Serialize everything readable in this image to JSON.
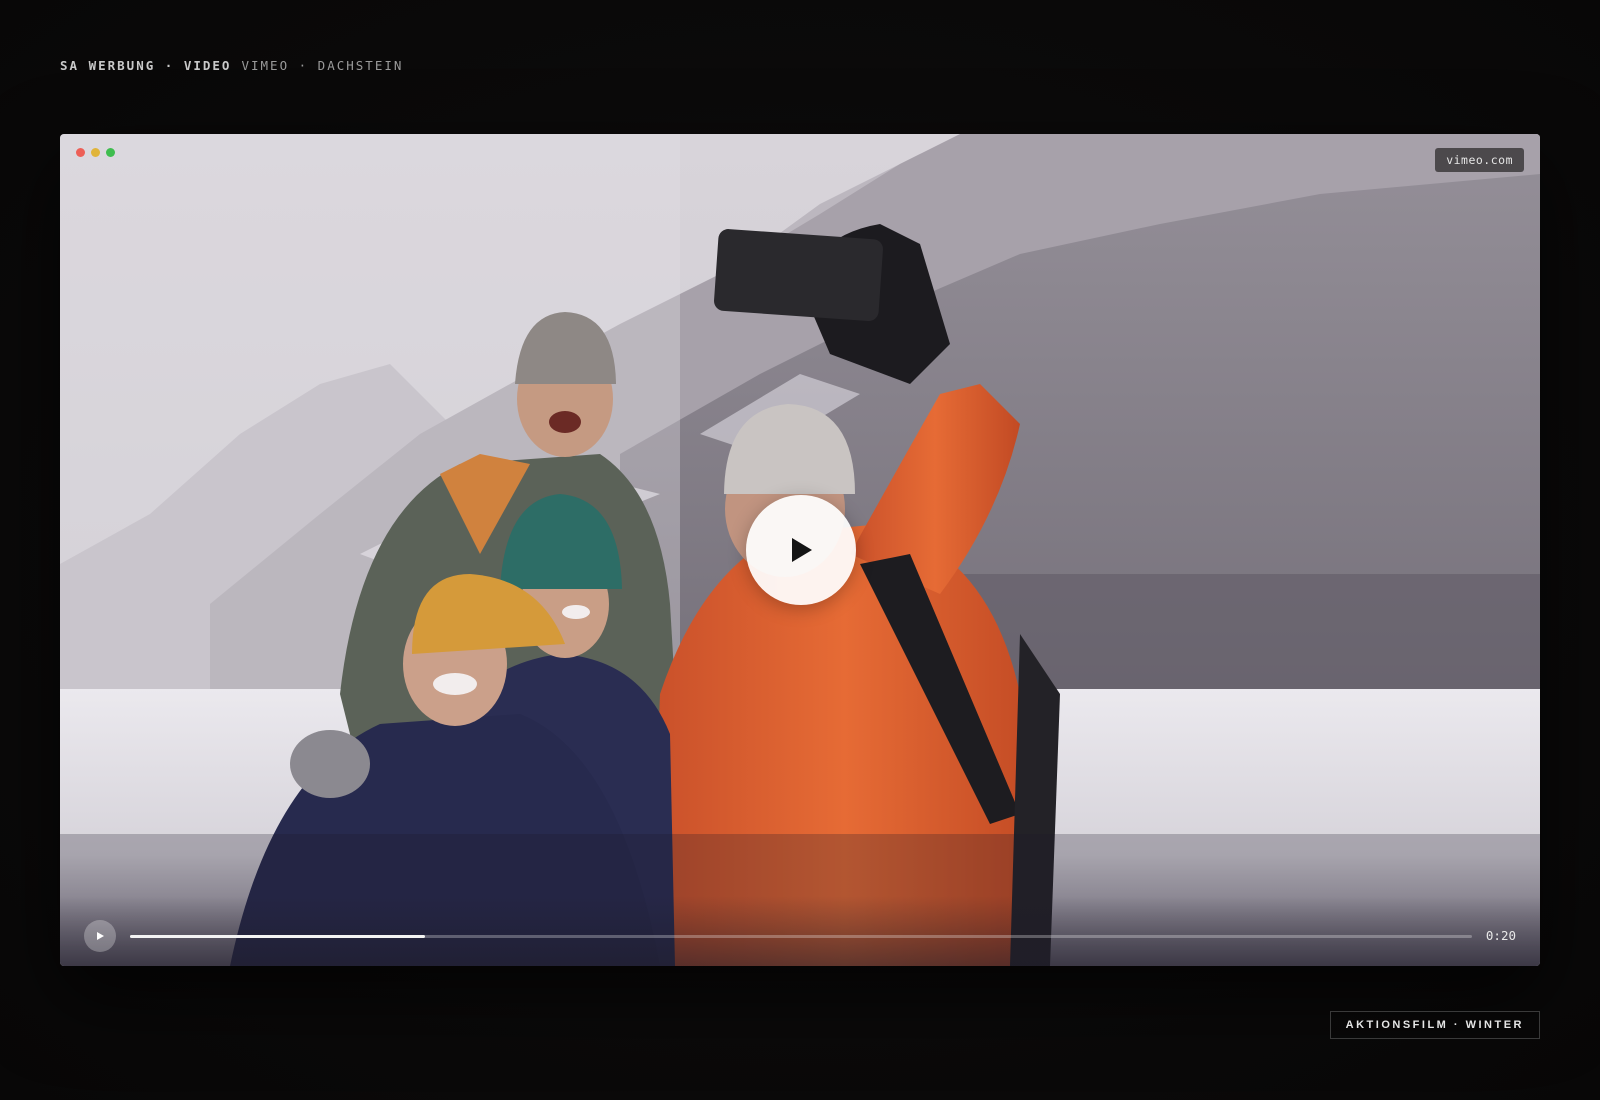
{
  "header": {
    "brand": "SA WERBUNG · VIDEO",
    "subtitle": "VIMEO · DACHSTEIN"
  },
  "window": {
    "dot_colors": [
      "#ed5f57",
      "#e0b43a",
      "#3fbd4f"
    ]
  },
  "player": {
    "source_badge": "vimeo.com",
    "big_play_icon": "play-icon",
    "small_play_icon": "play-icon",
    "time": "0:20",
    "progress": 0.22
  },
  "footer": {
    "tag": "AKTIONSFILM · WINTER"
  },
  "colors": {
    "page_bg": "#0b0a0a",
    "jacket_orange": "#e0602e",
    "teal_beanie": "#2d6d66",
    "mustard_beanie": "#d59a3a",
    "navy_jacket": "#272a4e"
  }
}
